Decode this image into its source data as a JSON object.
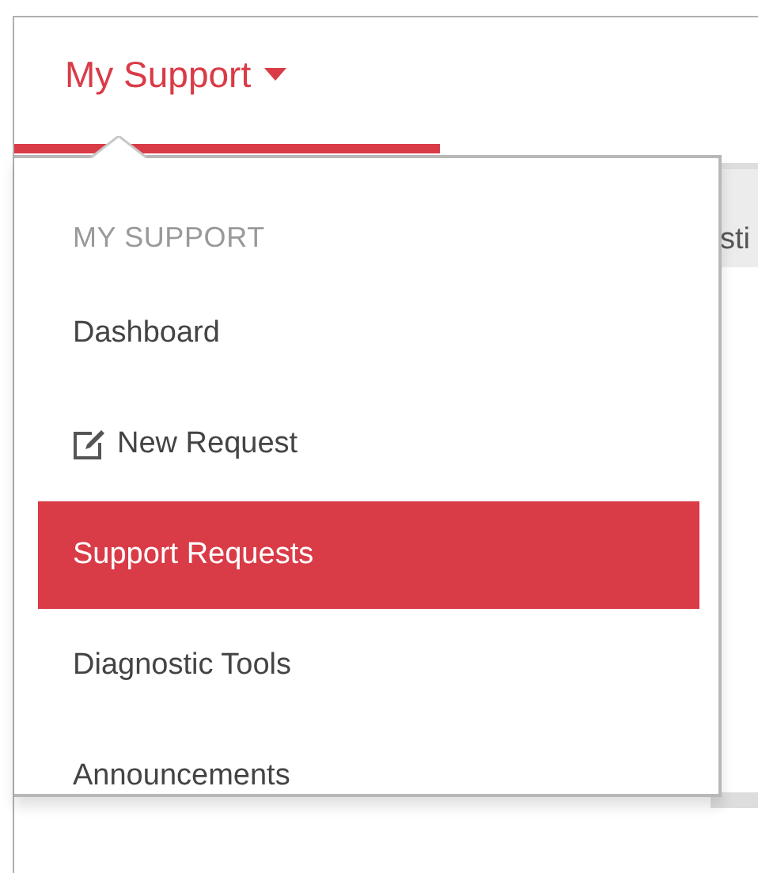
{
  "tab": {
    "label": "My Support",
    "selected": true
  },
  "background_text": "sti",
  "menu": {
    "header": "MY SUPPORT",
    "items": [
      {
        "label": "Dashboard",
        "selected": false
      },
      {
        "label": "New Request",
        "selected": false,
        "kind": "edit"
      },
      {
        "label": "Support Requests",
        "selected": true
      },
      {
        "label": "Diagnostic Tools",
        "selected": false
      },
      {
        "label": "Announcements",
        "selected": false
      }
    ]
  }
}
